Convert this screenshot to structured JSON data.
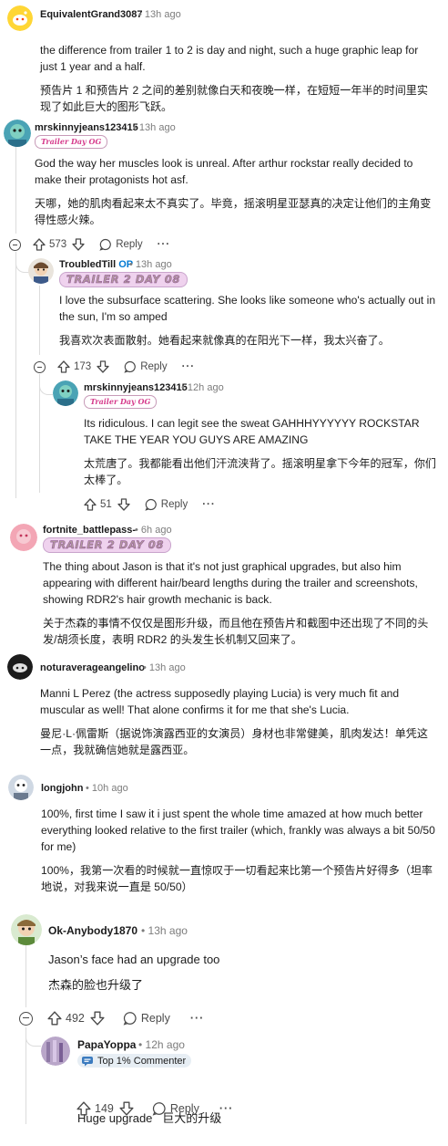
{
  "colors": {
    "op_blue": "#0079d3",
    "flair_pink": "#d63b8c",
    "flair_big_bg": "#efd2ee",
    "meta_gray": "#7c7c7c"
  },
  "comments": [
    {
      "username": "EquivalentGrand3087",
      "time": "13h ago",
      "text_en": "the difference from trailer 1 to 2 is day and night, such a huge graphic leap for just 1 year and a half.",
      "text_zh": "预告片 1 和预告片 2 之间的差别就像白天和夜晚一样，在短短一年半的时间里实现了如此巨大的图形飞跃。"
    },
    {
      "username": "mrskinnyjeans123415",
      "time": "13h ago",
      "flair": "Trailer Day OG",
      "text_en": "God the way her muscles look is unreal. After arthur rockstar really decided to make their protagonists hot asf.",
      "text_zh": "天哪，她的肌肉看起来太不真实了。毕竟，摇滚明星亚瑟真的决定让他们的主角变得性感火辣。",
      "votes": "573",
      "reply_label": "Reply"
    },
    {
      "username": "TroubledTill",
      "op": "OP",
      "time": "13h ago",
      "flair": "TRAILER 2 DAY 08",
      "text_en": "I love the subsurface scattering. She looks like someone who's actually out in the sun, I'm so amped",
      "text_zh": "我喜欢次表面散射。她看起来就像真的在阳光下一样，我太兴奋了。",
      "votes": "173",
      "reply_label": "Reply"
    },
    {
      "username": "mrskinnyjeans123415",
      "time": "12h ago",
      "flair": "Trailer Day OG",
      "text_en": "Its ridiculous. I can legit see the sweat GAHHHYYYYYY ROCKSTAR TAKE THE YEAR YOU GUYS ARE AMAZING",
      "text_zh": "太荒唐了。我都能看出他们汗流浃背了。摇滚明星拿下今年的冠军，你们太棒了。",
      "votes": "51",
      "reply_label": "Reply"
    },
    {
      "username": "fortnite_battlepass-",
      "time": "6h ago",
      "flair": "TRAILER 2 DAY 08",
      "text_en": "The thing about Jason is that it's not just graphical upgrades, but also him appearing with different hair/beard lengths during the trailer and screenshots, showing RDR2's hair growth mechanic is back.",
      "text_zh": "关于杰森的事情不仅仅是图形升级，而且他在预告片和截图中还出现了不同的头发/胡须长度，表明 RDR2 的头发生长机制又回来了。"
    },
    {
      "username": "noturaverageangelino",
      "time": "13h ago",
      "text_en": "Manni L Perez (the actress supposedly playing Lucia) is very much fit and muscular as well! That alone confirms it for me that she's Lucia.",
      "text_zh": "曼尼·L·佩雷斯（据说饰演露西亚的女演员）身材也非常健美，肌肉发达！单凭这一点，我就确信她就是露西亚。"
    },
    {
      "username": "longjohn",
      "time": "10h ago",
      "text_en": "100%, first time I saw it i just spent the whole time amazed at how much better everything looked relative to the first trailer (which, frankly was always a bit 50/50 for me)",
      "text_zh": "100%，我第一次看的时候就一直惊叹于一切看起来比第一个预告片好得多（坦率地说，对我来说一直是 50/50）"
    },
    {
      "username": "Ok-Anybody1870",
      "time": "13h ago",
      "text_en": "Jason’s face had an upgrade too",
      "text_zh": "杰森的脸也升级了",
      "votes": "492",
      "reply_label": "Reply"
    },
    {
      "username": "PapaYoppa",
      "time": "12h ago",
      "badge": "Top 1% Commenter",
      "text": "Huge upgrade   巨大的升级",
      "votes": "149",
      "reply_label": "Reply"
    }
  ],
  "separator": "•",
  "more_label": "···"
}
